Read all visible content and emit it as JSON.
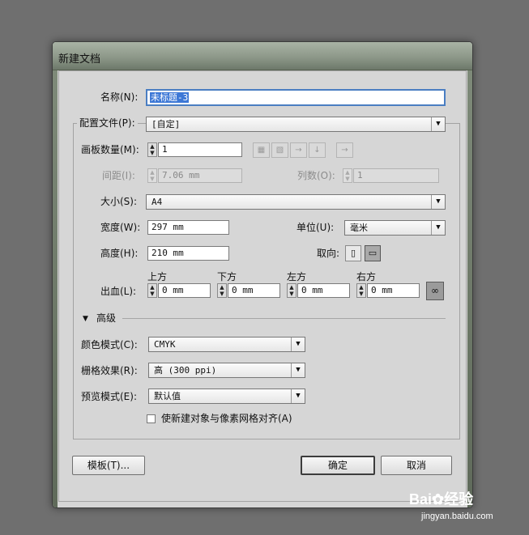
{
  "dialog": {
    "title": "新建文档",
    "name": {
      "label": "名称(N):",
      "value": "未标题-3"
    },
    "profile": {
      "label": "配置文件(P):",
      "value": "[自定]"
    },
    "artboards": {
      "label": "画板数量(M):",
      "value": "1"
    },
    "spacing": {
      "label": "间距(I):",
      "value": "7.06 mm"
    },
    "columns": {
      "label": "列数(O):",
      "value": "1"
    },
    "size": {
      "label": "大小(S):",
      "value": "A4"
    },
    "width": {
      "label": "宽度(W):",
      "value": "297 mm"
    },
    "height": {
      "label": "高度(H):",
      "value": "210 mm"
    },
    "units": {
      "label": "单位(U):",
      "value": "毫米"
    },
    "orientation": {
      "label": "取向:",
      "selected": "landscape"
    },
    "bleed": {
      "label": "出血(L):",
      "top": {
        "label": "上方",
        "value": "0 mm"
      },
      "bottom": {
        "label": "下方",
        "value": "0 mm"
      },
      "left": {
        "label": "左方",
        "value": "0 mm"
      },
      "right": {
        "label": "右方",
        "value": "0 mm"
      }
    },
    "advanced": {
      "label": "高级",
      "color_mode": {
        "label": "颜色模式(C):",
        "value": "CMYK"
      },
      "raster_effects": {
        "label": "栅格效果(R):",
        "value": "高 (300 ppi)"
      },
      "preview_mode": {
        "label": "预览模式(E):",
        "value": "默认值"
      },
      "align_pixel_grid": {
        "label": "使新建对象与像素网格对齐(A)",
        "checked": false
      }
    },
    "buttons": {
      "templates": "模板(T)...",
      "ok": "确定",
      "cancel": "取消"
    }
  },
  "watermark": {
    "brand": "Bai",
    "brand_suffix": "经验",
    "url": "jingyan.baidu.com"
  }
}
